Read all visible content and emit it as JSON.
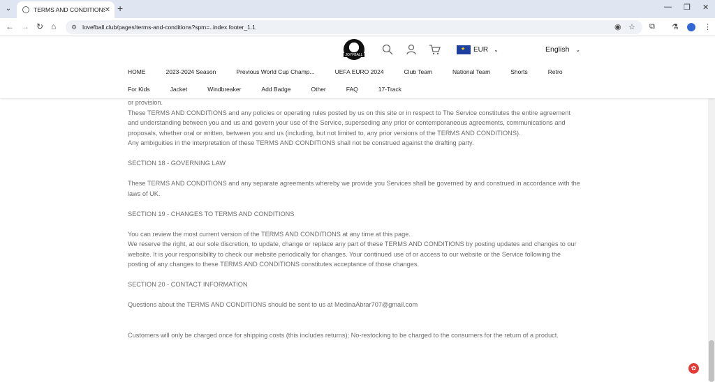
{
  "browser": {
    "tab_title": "TERMS AND CONDITIONS",
    "url": "lovefball.club/pages/terms-and-conditions?spm=..index.footer_1.1"
  },
  "header": {
    "logo_text": "JOYFBALL",
    "currency": "EUR",
    "language": "English"
  },
  "nav": {
    "row1": [
      "HOME",
      "2023-2024 Season",
      "Previous World Cup Champ...",
      "UEFA EURO 2024",
      "Club Team",
      "National Team",
      "Shorts",
      "Retro"
    ],
    "row2": [
      "For Kids",
      "Jacket",
      "Windbreaker",
      "Add Badge",
      "Other",
      "FAQ",
      "17-Track"
    ]
  },
  "content": {
    "p0": "or provision.",
    "p1": "These TERMS AND CONDITIONS and any policies or operating rules posted by us on this site or in respect to The Service constitutes the entire agreement and understanding between you and us and govern your use of the Service, superseding any prior or contemporaneous agreements, communications and proposals, whether oral or written, between you and us (including, but not limited to, any prior versions of the TERMS AND CONDITIONS).",
    "p2": "Any ambiguities in the interpretation of these TERMS AND CONDITIONS shall not be construed against the drafting party.",
    "s18": "SECTION 18 - GOVERNING LAW",
    "p3": "These TERMS AND CONDITIONS and any separate agreements whereby we provide you Services shall be governed by and construed in accordance with the laws of UK.",
    "s19": "SECTION 19 - CHANGES TO TERMS AND CONDITIONS",
    "p4": "You can review the most current version of the TERMS AND CONDITIONS at any time at this page.",
    "p5": "We reserve the right, at our sole discretion, to update, change or replace any part of these TERMS AND CONDITIONS by posting updates and changes to our website. It is your responsibility to check our website periodically for changes. Your continued use of or access to our website or the Service following the posting of any changes to these TERMS AND CONDITIONS constitutes acceptance of those changes.",
    "s20": "SECTION 20 - CONTACT INFORMATION",
    "p6": "Questions about the TERMS AND CONDITIONS should be sent to us at MedinaAbrar707@gmail.com",
    "p7": "Customers will only be charged once for shipping costs (this includes returns); No-restocking to be charged to the consumers for the return of a product."
  }
}
